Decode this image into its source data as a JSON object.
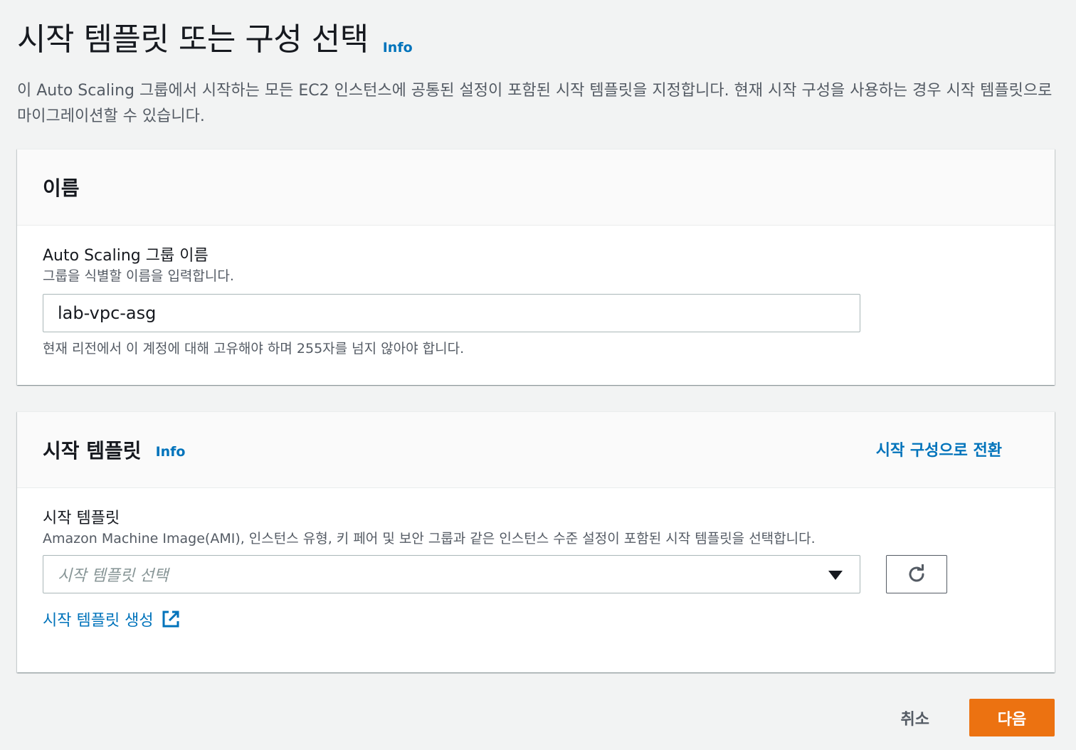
{
  "page": {
    "title": "시작 템플릿 또는 구성 선택",
    "info_label": "Info",
    "description": "이 Auto Scaling 그룹에서 시작하는 모든 EC2 인스턴스에 공통된 설정이 포함된 시작 템플릿을 지정합니다. 현재 시작 구성을 사용하는 경우 시작 템플릿으로 마이그레이션할 수 있습니다."
  },
  "name_panel": {
    "title": "이름",
    "field_label": "Auto Scaling 그룹 이름",
    "field_description": "그룹을 식별할 이름을 입력합니다.",
    "field_value": "lab-vpc-asg",
    "field_constraint": "현재 리전에서 이 계정에 대해 고유해야 하며 255자를 넘지 않아야 합니다."
  },
  "template_panel": {
    "title": "시작 템플릿",
    "info_label": "Info",
    "switch_link": "시작 구성으로 전환",
    "field_label": "시작 템플릿",
    "field_description": "Amazon Machine Image(AMI), 인스턴스 유형, 키 페어 및 보안 그룹과 같은 인스턴스 수준 설정이 포함된 시작 템플릿을 선택합니다.",
    "select_placeholder": "시작 템플릿 선택",
    "create_link": "시작 템플릿 생성"
  },
  "footer": {
    "cancel_label": "취소",
    "next_label": "다음"
  },
  "colors": {
    "link": "#0073bb",
    "primary_button": "#ec7211",
    "background": "#f2f3f3"
  },
  "icons": {
    "dropdown": "caret-down-icon",
    "refresh": "refresh-icon",
    "external": "external-link-icon"
  }
}
